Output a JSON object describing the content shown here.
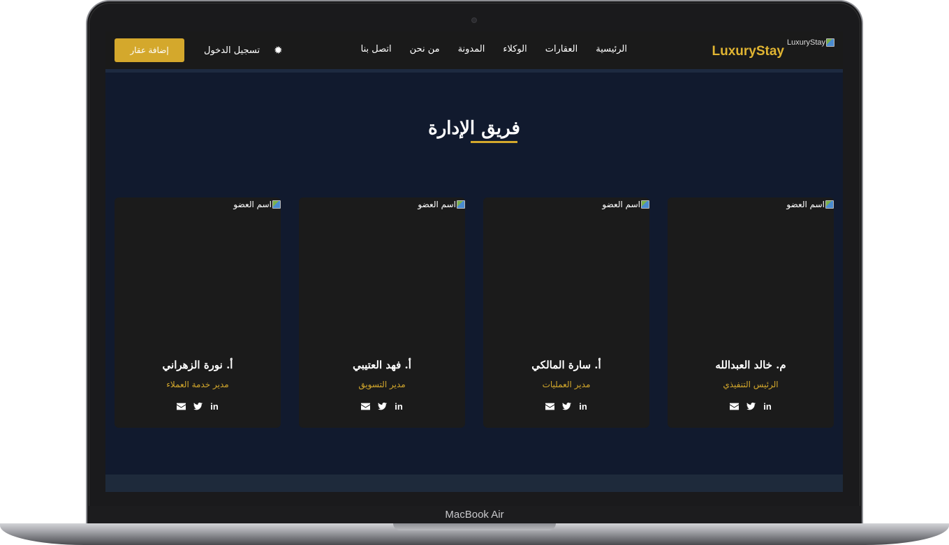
{
  "device": {
    "label": "MacBook Air"
  },
  "navbar": {
    "logo_text": "LuxuryStay",
    "logo_alt": "LuxuryStay",
    "links": [
      "الرئيسية",
      "العقارات",
      "الوكلاء",
      "المدونة",
      "من نحن",
      "اتصل بنا"
    ],
    "gear_icon": "gear-icon",
    "login_label": "تسجيل الدخول",
    "add_button_label": "إضافة عقار",
    "accent_color": "#d4a82c"
  },
  "section": {
    "title": "فريق الإدارة"
  },
  "team": [
    {
      "photo_alt": "اسم العضو",
      "name": "م. خالد العبدالله",
      "role": "الرئيس التنفيذي"
    },
    {
      "photo_alt": "اسم العضو",
      "name": "أ. سارة المالكي",
      "role": "مدير العمليات"
    },
    {
      "photo_alt": "اسم العضو",
      "name": "أ. فهد العتيبي",
      "role": "مدير التسويق"
    },
    {
      "photo_alt": "اسم العضو",
      "name": "أ. نورة الزهراني",
      "role": "مدير خدمة العملاء"
    }
  ],
  "social_icons": [
    "linkedin-icon",
    "twitter-icon",
    "envelope-icon"
  ],
  "social_linkedin_text": "in"
}
